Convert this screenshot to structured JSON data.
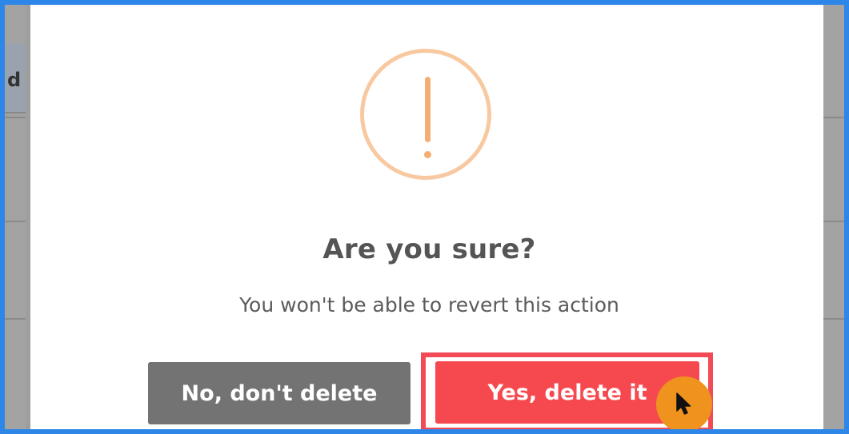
{
  "backdrop": {
    "header_fragment": "d"
  },
  "dialog": {
    "icon": "warning-exclamation-icon",
    "title": "Are you sure?",
    "message": "You won't be able to revert this action",
    "cancel_label": "No, don't delete",
    "confirm_label": "Yes, delete it"
  },
  "colors": {
    "frame_border": "#2e86e8",
    "warning_icon": "#f5ae72",
    "confirm_button": "#f5484f",
    "cancel_button": "#737373",
    "highlight": "#f24b56",
    "cursor_badge": "#f0921e"
  },
  "cursor": {
    "icon": "mouse-pointer-icon"
  }
}
